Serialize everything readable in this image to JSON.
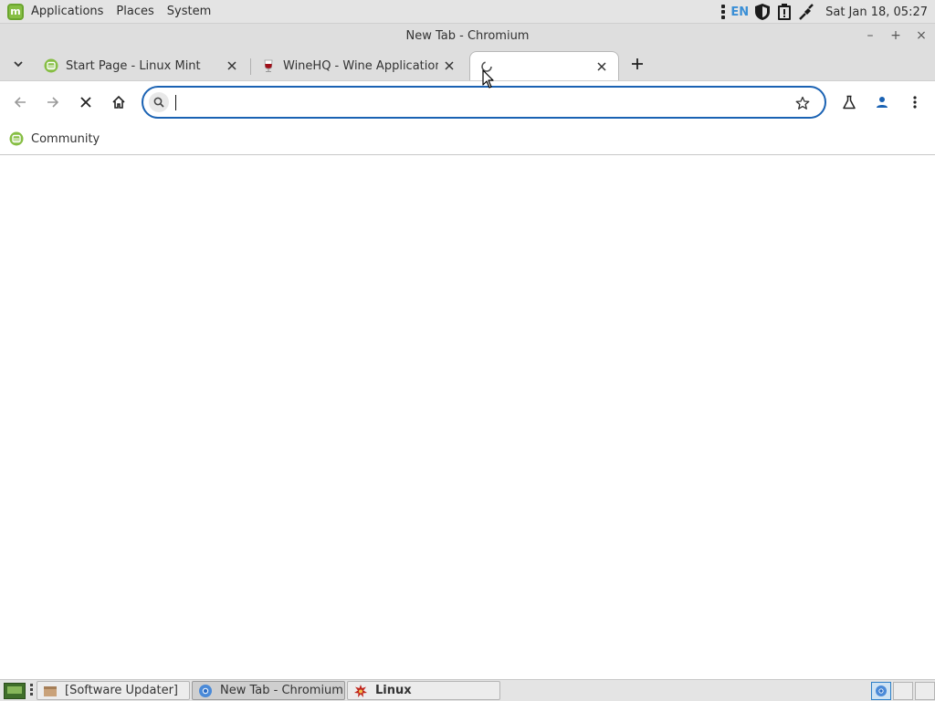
{
  "top_panel": {
    "menus": [
      "Applications",
      "Places",
      "System"
    ],
    "language": "EN",
    "clock": "Sat Jan 18, 05:27"
  },
  "window": {
    "title": "New Tab - Chromium",
    "controls": {
      "minimize": "–",
      "maximize": "+",
      "close": "×"
    }
  },
  "tabs": [
    {
      "title": "Start Page - Linux Mint",
      "favicon": "linux-mint-icon",
      "active": false
    },
    {
      "title": "WineHQ - Wine Application D",
      "favicon": "wine-glass-icon",
      "active": false
    },
    {
      "title": "",
      "favicon": "loading-icon",
      "active": true
    }
  ],
  "toolbar": {
    "omnibox": {
      "value": "",
      "placeholder": ""
    }
  },
  "bookmarks": [
    {
      "label": "Community",
      "icon": "linux-mint-icon"
    }
  ],
  "taskbar": {
    "tasks": [
      {
        "label": "[Software Updater]",
        "icon": "software-updater-icon",
        "active": false
      },
      {
        "label": "New Tab - Chromium",
        "icon": "chromium-icon",
        "active": true
      },
      {
        "label": "Linux",
        "icon": "wine-icon",
        "active": false,
        "bold": true
      }
    ]
  },
  "colors": {
    "accent": "#1a62b3",
    "mint_green": "#86be43",
    "panel_bg": "#e4e4e4"
  }
}
